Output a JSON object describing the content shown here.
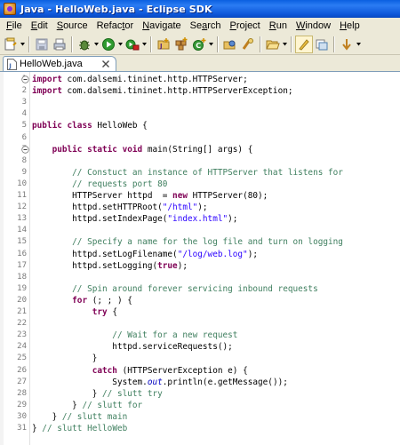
{
  "window": {
    "title": "Java - HelloWeb.java - Eclipse SDK"
  },
  "menu": [
    {
      "pre": "",
      "u": "F",
      "post": "ile"
    },
    {
      "pre": "",
      "u": "E",
      "post": "dit"
    },
    {
      "pre": "",
      "u": "S",
      "post": "ource"
    },
    {
      "pre": "Refac",
      "u": "t",
      "post": "or"
    },
    {
      "pre": "",
      "u": "N",
      "post": "avigate"
    },
    {
      "pre": "Se",
      "u": "a",
      "post": "rch"
    },
    {
      "pre": "",
      "u": "P",
      "post": "roject"
    },
    {
      "pre": "",
      "u": "R",
      "post": "un"
    },
    {
      "pre": "",
      "u": "W",
      "post": "indow"
    },
    {
      "pre": "",
      "u": "H",
      "post": "elp"
    }
  ],
  "toolbar_icons": [
    "new-wizard-icon",
    "save-icon",
    "print-icon",
    "debug-icon",
    "run-icon",
    "external-tools-icon",
    "new-java-project-icon",
    "new-package-icon",
    "new-class-icon",
    "open-type-icon",
    "search-icon",
    "open-folder-icon",
    "toggle-highlight-icon",
    "show-whitespace-icon",
    "next-annotation-icon"
  ],
  "editor": {
    "tab_label": "HelloWeb.java",
    "lines": [
      {
        "n": "1",
        "fold": "minus",
        "parts": [
          {
            "t": "import",
            "c": "kw"
          },
          {
            "t": " com.dalsemi.tininet.http.HTTPServer;",
            "c": ""
          }
        ]
      },
      {
        "n": "2",
        "fold": "",
        "parts": [
          {
            "t": "import",
            "c": "kw"
          },
          {
            "t": " com.dalsemi.tininet.http.HTTPServerException;",
            "c": ""
          }
        ]
      },
      {
        "n": "3",
        "fold": "",
        "parts": []
      },
      {
        "n": "4",
        "fold": "",
        "parts": []
      },
      {
        "n": "5",
        "fold": "",
        "parts": [
          {
            "t": "public class",
            "c": "kw"
          },
          {
            "t": " HelloWeb {",
            "c": ""
          }
        ]
      },
      {
        "n": "6",
        "fold": "",
        "parts": []
      },
      {
        "n": "7",
        "fold": "minus",
        "parts": [
          {
            "t": "    ",
            "c": ""
          },
          {
            "t": "public static void",
            "c": "kw"
          },
          {
            "t": " main(String[] args) {",
            "c": ""
          }
        ]
      },
      {
        "n": "8",
        "fold": "",
        "parts": []
      },
      {
        "n": "9",
        "fold": "",
        "parts": [
          {
            "t": "        // Constuct an instance of HTTPServer that listens for",
            "c": "cm"
          }
        ]
      },
      {
        "n": "10",
        "fold": "",
        "parts": [
          {
            "t": "        // requests port 80",
            "c": "cm"
          }
        ]
      },
      {
        "n": "11",
        "fold": "",
        "parts": [
          {
            "t": "        HTTPServer httpd  = ",
            "c": ""
          },
          {
            "t": "new",
            "c": "kw"
          },
          {
            "t": " HTTPServer(80);",
            "c": ""
          }
        ]
      },
      {
        "n": "12",
        "fold": "",
        "parts": [
          {
            "t": "        httpd.setHTTPRoot(",
            "c": ""
          },
          {
            "t": "\"/html\"",
            "c": "st"
          },
          {
            "t": ");",
            "c": ""
          }
        ]
      },
      {
        "n": "13",
        "fold": "",
        "parts": [
          {
            "t": "        httpd.setIndexPage(",
            "c": ""
          },
          {
            "t": "\"index.html\"",
            "c": "st"
          },
          {
            "t": ");",
            "c": ""
          }
        ]
      },
      {
        "n": "14",
        "fold": "",
        "parts": []
      },
      {
        "n": "15",
        "fold": "",
        "parts": [
          {
            "t": "        // Specify a name for the log file and turn on logging",
            "c": "cm"
          }
        ]
      },
      {
        "n": "16",
        "fold": "",
        "parts": [
          {
            "t": "        httpd.setLogFilename(",
            "c": ""
          },
          {
            "t": "\"/log/web.log\"",
            "c": "st"
          },
          {
            "t": ");",
            "c": ""
          }
        ]
      },
      {
        "n": "17",
        "fold": "",
        "parts": [
          {
            "t": "        httpd.setLogging(",
            "c": ""
          },
          {
            "t": "true",
            "c": "kw"
          },
          {
            "t": ");",
            "c": ""
          }
        ]
      },
      {
        "n": "18",
        "fold": "",
        "parts": []
      },
      {
        "n": "19",
        "fold": "",
        "parts": [
          {
            "t": "        // Spin around forever servicing inbound requests",
            "c": "cm"
          }
        ]
      },
      {
        "n": "20",
        "fold": "",
        "parts": [
          {
            "t": "        ",
            "c": ""
          },
          {
            "t": "for",
            "c": "kw"
          },
          {
            "t": " (; ; ) {",
            "c": ""
          }
        ]
      },
      {
        "n": "21",
        "fold": "",
        "parts": [
          {
            "t": "            ",
            "c": ""
          },
          {
            "t": "try",
            "c": "kw"
          },
          {
            "t": " {",
            "c": ""
          }
        ]
      },
      {
        "n": "22",
        "fold": "",
        "parts": []
      },
      {
        "n": "23",
        "fold": "",
        "parts": [
          {
            "t": "                // Wait for a new request",
            "c": "cm"
          }
        ]
      },
      {
        "n": "24",
        "fold": "",
        "parts": [
          {
            "t": "                httpd.serviceRequests();",
            "c": ""
          }
        ]
      },
      {
        "n": "25",
        "fold": "",
        "parts": [
          {
            "t": "            }",
            "c": ""
          }
        ]
      },
      {
        "n": "26",
        "fold": "",
        "parts": [
          {
            "t": "            ",
            "c": ""
          },
          {
            "t": "catch",
            "c": "kw"
          },
          {
            "t": " (HTTPServerException e) {",
            "c": ""
          }
        ]
      },
      {
        "n": "27",
        "fold": "",
        "parts": [
          {
            "t": "                System.",
            "c": ""
          },
          {
            "t": "out",
            "c": "fld"
          },
          {
            "t": ".println(e.getMessage());",
            "c": ""
          }
        ]
      },
      {
        "n": "28",
        "fold": "",
        "parts": [
          {
            "t": "            } ",
            "c": ""
          },
          {
            "t": "// slutt try",
            "c": "cm"
          }
        ]
      },
      {
        "n": "29",
        "fold": "",
        "parts": [
          {
            "t": "        } ",
            "c": ""
          },
          {
            "t": "// slutt for",
            "c": "cm"
          }
        ]
      },
      {
        "n": "30",
        "fold": "",
        "parts": [
          {
            "t": "    } ",
            "c": ""
          },
          {
            "t": "// slutt main",
            "c": "cm"
          }
        ]
      },
      {
        "n": "31",
        "fold": "",
        "parts": [
          {
            "t": "} ",
            "c": ""
          },
          {
            "t": "// slutt HelloWeb",
            "c": "cm"
          }
        ]
      }
    ]
  }
}
